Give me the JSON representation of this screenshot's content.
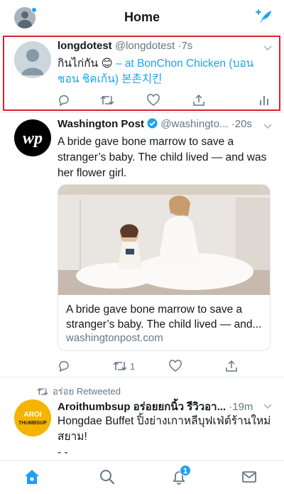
{
  "header": {
    "title": "Home"
  },
  "tweets": [
    {
      "name": "longdotest",
      "handle": "@longdotest",
      "time": "·7s",
      "text_before": "กินไก่กัน ",
      "emoji": "😊",
      "text_link": " – at BonChon Chicken (บอนชอน ชิคเก้น) 본촌치킨",
      "actions": {
        "reply": "",
        "retweet": "",
        "like": "",
        "share": "",
        "analytics": ""
      }
    },
    {
      "name": "Washington Post",
      "handle": "@washingto...",
      "time": "·20s",
      "text": "A bride gave bone marrow to save a stranger’s baby. The child lived — and was her flower girl.",
      "card": {
        "title": "A bride gave bone marrow to save a stranger’s baby. The child lived — and...",
        "domain": "washingtonpost.com"
      },
      "actions": {
        "reply": "",
        "retweet": "1",
        "like": "",
        "share": ""
      }
    },
    {
      "retweeted_by": "อร่อย Retweeted",
      "name": "Aroithumbsup อร่อยยกนิ้ว รีวิวอา...",
      "time": "·19m",
      "text": "Hongdae Buffet ปิ้งย่างเกาหลีบุฟเฟ่ต์ร้านใหม่สยาม!",
      "text_more": "- -",
      "logo_text_top": "AROI",
      "logo_text_bottom": "THUMBSUP"
    }
  ],
  "tabbar": {
    "notifications_badge": "1"
  },
  "colors": {
    "accent": "#1da1f2",
    "highlight": "#e0202b",
    "secondary_text": "#657786"
  }
}
